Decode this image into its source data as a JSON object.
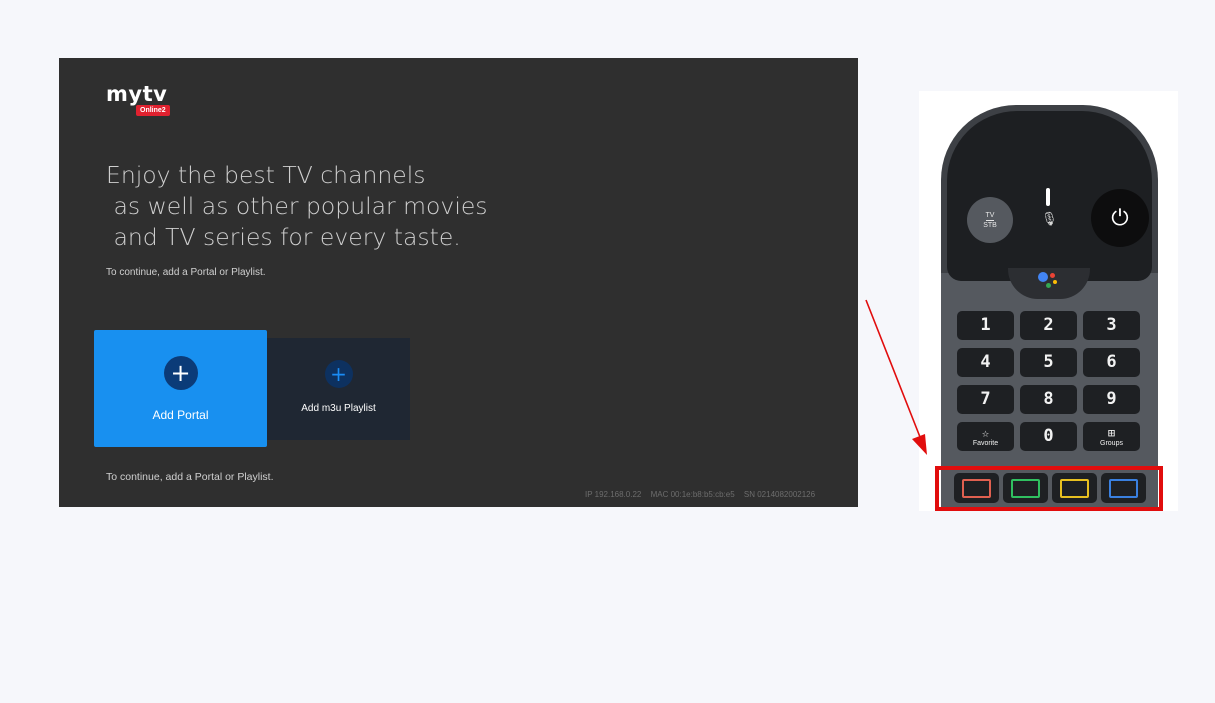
{
  "tv_screen": {
    "logo": {
      "word": "mytv",
      "badge": "Online2"
    },
    "headline": "Enjoy the best TV channels\n as well as other popular movies\n and TV series for every taste.",
    "hint_top": "To continue, add a Portal or Playlist.",
    "tiles": [
      {
        "label": "Add Portal",
        "icon": "plus-icon"
      },
      {
        "label": "Add m3u Playlist",
        "icon": "plus-icon"
      }
    ],
    "hint_bottom": "To continue, add a Portal or Playlist.",
    "device_info": {
      "ip": "IP 192.168.0.22",
      "mac": "MAC 00:1e:b8:b5:cb:e5",
      "sn": "SN 0214082002126"
    }
  },
  "remote": {
    "tv_stb": {
      "top": "TV",
      "bottom": "STB"
    },
    "power_icon": "⏻",
    "mic_icon": "🎙",
    "number_keys": [
      "1",
      "2",
      "3",
      "4",
      "5",
      "6",
      "7",
      "8",
      "9"
    ],
    "favorite": {
      "glyph": "☆",
      "label": "Favorite"
    },
    "zero": "0",
    "groups": {
      "glyph": "⊞",
      "label": "Groups"
    },
    "color_buttons": [
      {
        "name": "red",
        "color": "#e06050"
      },
      {
        "name": "green",
        "color": "#30c060"
      },
      {
        "name": "yellow",
        "color": "#e8c020"
      },
      {
        "name": "blue",
        "color": "#3a80e0"
      }
    ],
    "highlight_color": "#e10d0d"
  }
}
